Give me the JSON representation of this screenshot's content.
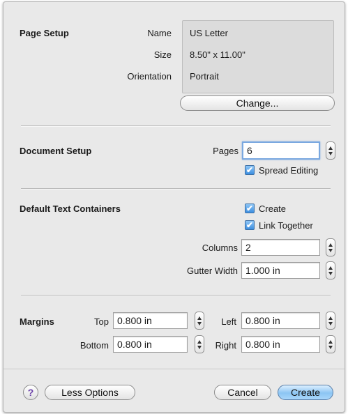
{
  "page_setup": {
    "title": "Page Setup",
    "name_label": "Name",
    "name_value": "US Letter",
    "size_label": "Size",
    "size_value": "8.50\" x 11.00\"",
    "orientation_label": "Orientation",
    "orientation_value": "Portrait",
    "change_button": "Change..."
  },
  "document_setup": {
    "title": "Document Setup",
    "pages_label": "Pages",
    "pages_value": "6",
    "spread_editing_label": "Spread Editing",
    "spread_editing_checked": true
  },
  "text_containers": {
    "title": "Default Text Containers",
    "create_label": "Create",
    "create_checked": true,
    "link_together_label": "Link Together",
    "link_together_checked": true,
    "columns_label": "Columns",
    "columns_value": "2",
    "gutter_label": "Gutter Width",
    "gutter_value": "1.000 in"
  },
  "margins": {
    "title": "Margins",
    "top_label": "Top",
    "top_value": "0.800 in",
    "bottom_label": "Bottom",
    "bottom_value": "0.800 in",
    "left_label": "Left",
    "left_value": "0.800 in",
    "right_label": "Right",
    "right_value": "0.800 in"
  },
  "footer": {
    "help_label": "?",
    "less_options_button": "Less Options",
    "cancel_button": "Cancel",
    "create_button": "Create"
  },
  "icons": {
    "check_mark": "✔",
    "stepper": "up-down-arrows"
  },
  "colors": {
    "accent": "#7aa8e0",
    "default_button": "#8cc5f3",
    "checkbox": "#3d8fe0"
  }
}
